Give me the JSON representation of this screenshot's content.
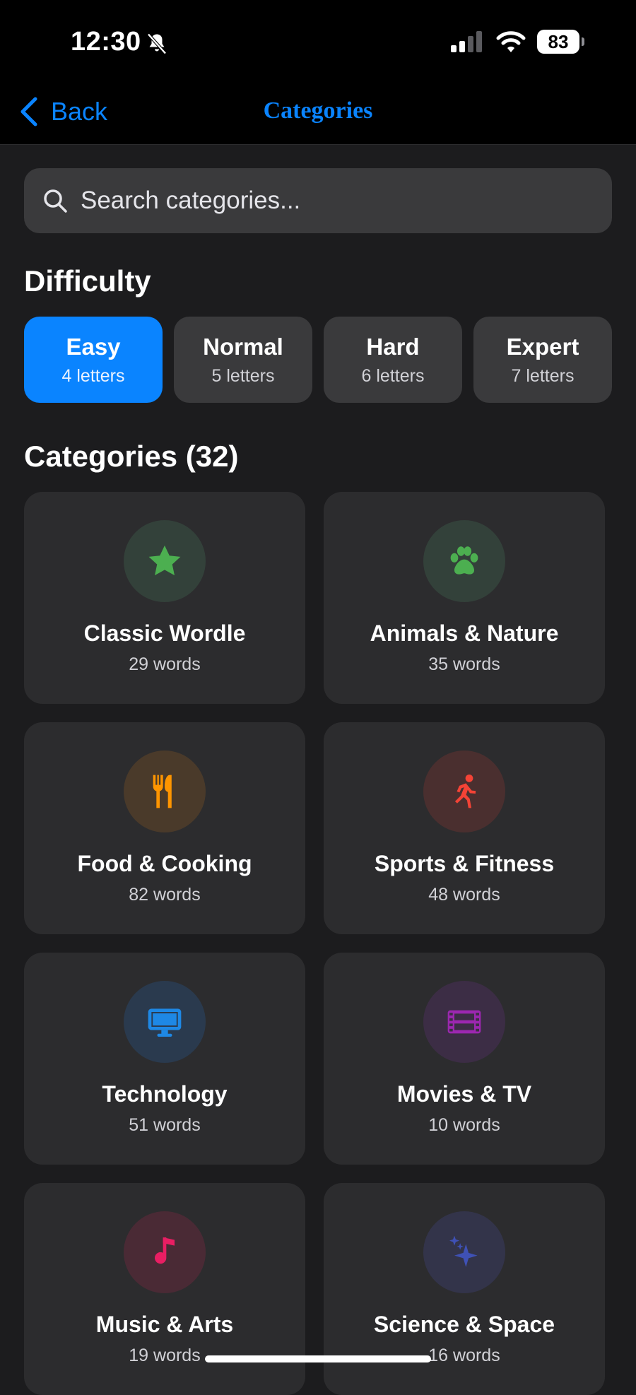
{
  "status_bar": {
    "time": "12:30",
    "battery": "83"
  },
  "nav": {
    "back_label": "Back",
    "title": "Categories"
  },
  "search": {
    "placeholder": "Search categories..."
  },
  "difficulty": {
    "heading": "Difficulty",
    "options": [
      {
        "label": "Easy",
        "sub": "4 letters",
        "selected": true
      },
      {
        "label": "Normal",
        "sub": "5 letters",
        "selected": false
      },
      {
        "label": "Hard",
        "sub": "6 letters",
        "selected": false
      },
      {
        "label": "Expert",
        "sub": "7 letters",
        "selected": false
      }
    ]
  },
  "categories": {
    "heading": "Categories (32)",
    "items": [
      {
        "name": "Classic Wordle",
        "count": "29 words",
        "icon": "star-icon",
        "color": "#4caf50",
        "bg": "#33413a"
      },
      {
        "name": "Animals & Nature",
        "count": "35 words",
        "icon": "paw-icon",
        "color": "#4caf50",
        "bg": "#33413a"
      },
      {
        "name": "Food & Cooking",
        "count": "82 words",
        "icon": "fork-knife-icon",
        "color": "#ff9500",
        "bg": "#4a3a2a"
      },
      {
        "name": "Sports & Fitness",
        "count": "48 words",
        "icon": "running-icon",
        "color": "#f44336",
        "bg": "#4a2f2f"
      },
      {
        "name": "Technology",
        "count": "51 words",
        "icon": "monitor-icon",
        "color": "#1e88e5",
        "bg": "#2a3a4e"
      },
      {
        "name": "Movies & TV",
        "count": "10 words",
        "icon": "film-icon",
        "color": "#9c27b0",
        "bg": "#3c2d45"
      },
      {
        "name": "Music & Arts",
        "count": "19 words",
        "icon": "music-note-icon",
        "color": "#e91e63",
        "bg": "#4a2a35"
      },
      {
        "name": "Science & Space",
        "count": "16 words",
        "icon": "sparkles-icon",
        "color": "#3f51b5",
        "bg": "#33344a"
      }
    ]
  }
}
